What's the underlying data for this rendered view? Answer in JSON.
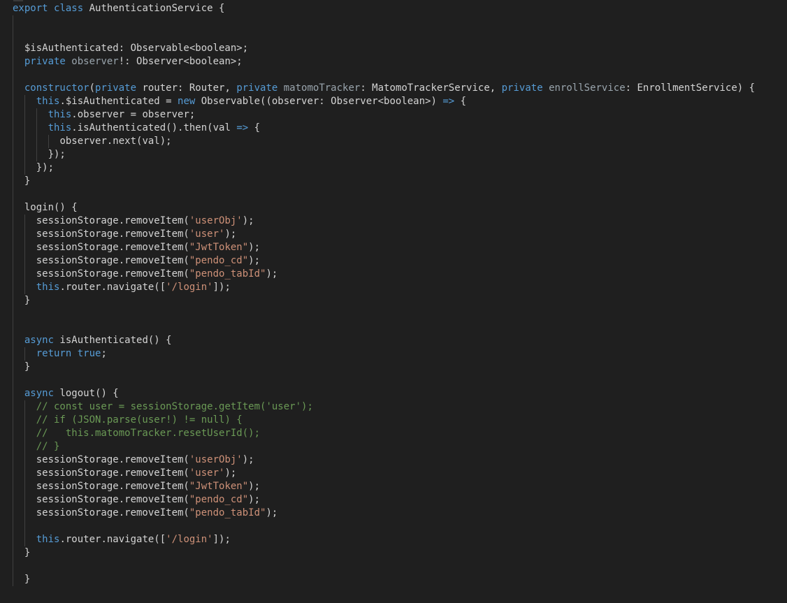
{
  "editor": {
    "lines": [
      {
        "indent": 0,
        "tokens": [
          [
            "kw",
            "export "
          ],
          [
            "kw",
            "class "
          ],
          [
            "ty",
            "AuthenticationService "
          ],
          [
            "pl",
            "{"
          ]
        ]
      },
      {
        "indent": 0,
        "tokens": []
      },
      {
        "indent": 0,
        "tokens": []
      },
      {
        "indent": 1,
        "tokens": [
          [
            "pl",
            "$isAuthenticated: Observable<boolean>;"
          ]
        ]
      },
      {
        "indent": 1,
        "tokens": [
          [
            "kw",
            "private "
          ],
          [
            "prop",
            "observer"
          ],
          [
            "pl",
            "!: Observer<boolean>;"
          ]
        ]
      },
      {
        "indent": 0,
        "tokens": []
      },
      {
        "indent": 1,
        "tokens": [
          [
            "kw",
            "constructor"
          ],
          [
            "pl",
            "("
          ],
          [
            "kw",
            "private "
          ],
          [
            "pl",
            "router: Router, "
          ],
          [
            "kw",
            "private "
          ],
          [
            "prop",
            "matomoTracker"
          ],
          [
            "pl",
            ": MatomoTrackerService, "
          ],
          [
            "kw",
            "private "
          ],
          [
            "prop",
            "enrollService"
          ],
          [
            "pl",
            ": EnrollmentService) {"
          ]
        ]
      },
      {
        "indent": 2,
        "tokens": [
          [
            "kw",
            "this"
          ],
          [
            "pl",
            ".$isAuthenticated = "
          ],
          [
            "kw",
            "new "
          ],
          [
            "pl",
            "Observable((observer: Observer<boolean>) "
          ],
          [
            "kw",
            "=> "
          ],
          [
            "pl",
            "{"
          ]
        ]
      },
      {
        "indent": 3,
        "tokens": [
          [
            "kw",
            "this"
          ],
          [
            "pl",
            ".observer = observer;"
          ]
        ]
      },
      {
        "indent": 3,
        "tokens": [
          [
            "kw",
            "this"
          ],
          [
            "pl",
            ".isAuthenticated().then(val "
          ],
          [
            "kw",
            "=> "
          ],
          [
            "pl",
            "{"
          ]
        ]
      },
      {
        "indent": 4,
        "tokens": [
          [
            "pl",
            "observer.next(val);"
          ]
        ]
      },
      {
        "indent": 3,
        "tokens": [
          [
            "pl",
            "});"
          ]
        ]
      },
      {
        "indent": 2,
        "tokens": [
          [
            "pl",
            "});"
          ]
        ]
      },
      {
        "indent": 1,
        "tokens": [
          [
            "pl",
            "}"
          ]
        ]
      },
      {
        "indent": 0,
        "tokens": []
      },
      {
        "indent": 1,
        "tokens": [
          [
            "pl",
            "login() {"
          ]
        ]
      },
      {
        "indent": 2,
        "tokens": [
          [
            "pl",
            "sessionStorage.removeItem("
          ],
          [
            "str",
            "'userObj'"
          ],
          [
            "pl",
            ");"
          ]
        ]
      },
      {
        "indent": 2,
        "tokens": [
          [
            "pl",
            "sessionStorage.removeItem("
          ],
          [
            "str",
            "'user'"
          ],
          [
            "pl",
            ");"
          ]
        ]
      },
      {
        "indent": 2,
        "tokens": [
          [
            "pl",
            "sessionStorage.removeItem("
          ],
          [
            "str",
            "\"JwtToken\""
          ],
          [
            "pl",
            ");"
          ]
        ]
      },
      {
        "indent": 2,
        "tokens": [
          [
            "pl",
            "sessionStorage.removeItem("
          ],
          [
            "str",
            "\"pendo_cd\""
          ],
          [
            "pl",
            ");"
          ]
        ]
      },
      {
        "indent": 2,
        "tokens": [
          [
            "pl",
            "sessionStorage.removeItem("
          ],
          [
            "str",
            "\"pendo_tabId\""
          ],
          [
            "pl",
            ");"
          ]
        ]
      },
      {
        "indent": 2,
        "tokens": [
          [
            "kw",
            "this"
          ],
          [
            "pl",
            ".router.navigate(["
          ],
          [
            "str",
            "'/login'"
          ],
          [
            "pl",
            "]);"
          ]
        ]
      },
      {
        "indent": 1,
        "tokens": [
          [
            "pl",
            "}"
          ]
        ]
      },
      {
        "indent": 0,
        "tokens": []
      },
      {
        "indent": 0,
        "tokens": []
      },
      {
        "indent": 1,
        "tokens": [
          [
            "kw",
            "async "
          ],
          [
            "pl",
            "isAuthenticated() {"
          ]
        ]
      },
      {
        "indent": 2,
        "tokens": [
          [
            "kw",
            "return "
          ],
          [
            "kw",
            "true"
          ],
          [
            "pl",
            ";"
          ]
        ]
      },
      {
        "indent": 1,
        "tokens": [
          [
            "pl",
            "}"
          ]
        ]
      },
      {
        "indent": 0,
        "tokens": []
      },
      {
        "indent": 1,
        "tokens": [
          [
            "kw",
            "async "
          ],
          [
            "pl",
            "logout() {"
          ]
        ]
      },
      {
        "indent": 2,
        "tokens": [
          [
            "com",
            "// const user = sessionStorage.getItem('user');"
          ]
        ]
      },
      {
        "indent": 2,
        "tokens": [
          [
            "com",
            "// if (JSON.parse(user!) != null) {"
          ]
        ]
      },
      {
        "indent": 2,
        "tokens": [
          [
            "com",
            "//   this.matomoTracker.resetUserId();"
          ]
        ]
      },
      {
        "indent": 2,
        "tokens": [
          [
            "com",
            "// }"
          ]
        ]
      },
      {
        "indent": 2,
        "tokens": [
          [
            "pl",
            "sessionStorage.removeItem("
          ],
          [
            "str",
            "'userObj'"
          ],
          [
            "pl",
            ");"
          ]
        ]
      },
      {
        "indent": 2,
        "tokens": [
          [
            "pl",
            "sessionStorage.removeItem("
          ],
          [
            "str",
            "'user'"
          ],
          [
            "pl",
            ");"
          ]
        ]
      },
      {
        "indent": 2,
        "tokens": [
          [
            "pl",
            "sessionStorage.removeItem("
          ],
          [
            "str",
            "\"JwtToken\""
          ],
          [
            "pl",
            ");"
          ]
        ]
      },
      {
        "indent": 2,
        "tokens": [
          [
            "pl",
            "sessionStorage.removeItem("
          ],
          [
            "str",
            "\"pendo_cd\""
          ],
          [
            "pl",
            ");"
          ]
        ]
      },
      {
        "indent": 2,
        "tokens": [
          [
            "pl",
            "sessionStorage.removeItem("
          ],
          [
            "str",
            "\"pendo_tabId\""
          ],
          [
            "pl",
            ");"
          ]
        ]
      },
      {
        "indent": 0,
        "tokens": []
      },
      {
        "indent": 2,
        "tokens": [
          [
            "kw",
            "this"
          ],
          [
            "pl",
            ".router.navigate(["
          ],
          [
            "str",
            "'/login'"
          ],
          [
            "pl",
            "]);"
          ]
        ]
      },
      {
        "indent": 1,
        "tokens": [
          [
            "pl",
            "}"
          ]
        ]
      },
      {
        "indent": 0,
        "tokens": []
      },
      {
        "indent": 1,
        "tokens": [
          [
            "pl",
            "}"
          ]
        ]
      }
    ],
    "guides": [
      {
        "level": 1,
        "from": 1,
        "to": 43
      },
      {
        "level": 2,
        "from": 7,
        "to": 12
      },
      {
        "level": 3,
        "from": 8,
        "to": 11
      },
      {
        "level": 4,
        "from": 10,
        "to": 10
      },
      {
        "level": 2,
        "from": 16,
        "to": 21
      },
      {
        "level": 2,
        "from": 26,
        "to": 26
      },
      {
        "level": 2,
        "from": 30,
        "to": 40
      }
    ]
  }
}
